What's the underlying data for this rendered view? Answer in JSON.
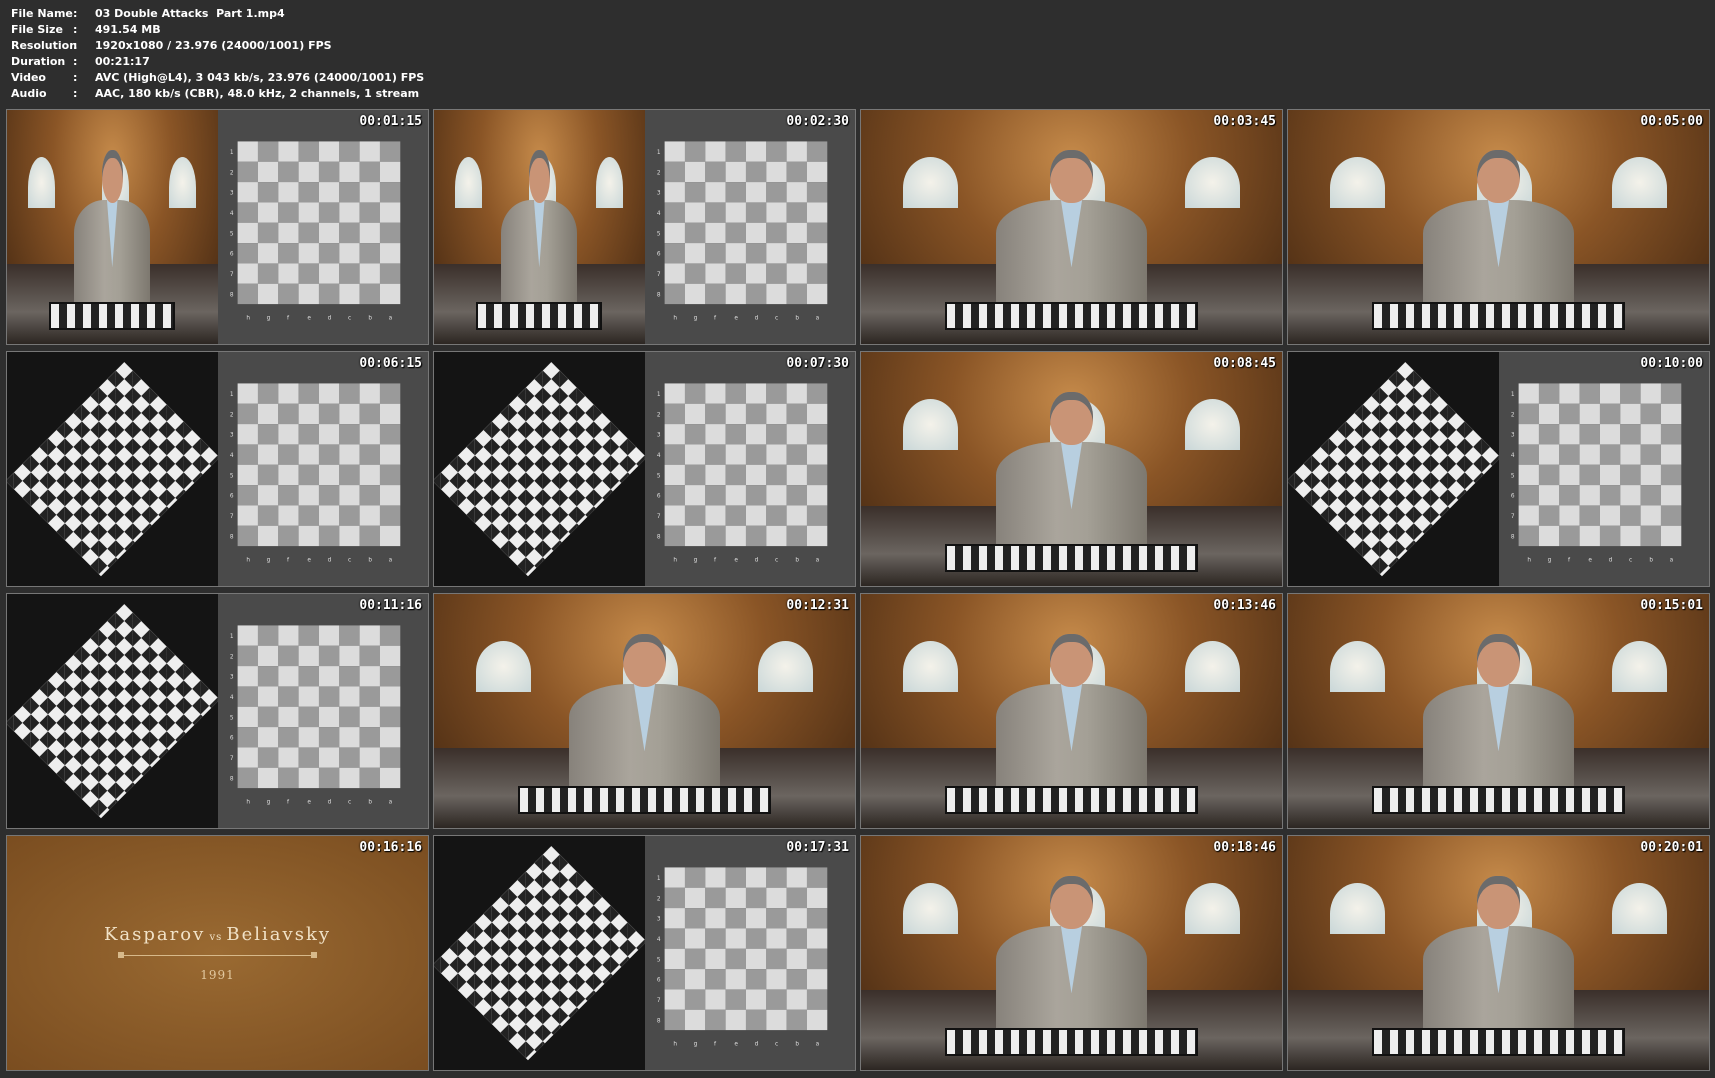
{
  "info": {
    "rows": [
      {
        "key": "File Name",
        "value": "03 Double Attacks  Part 1.mp4"
      },
      {
        "key": "File Size",
        "value": "491.54 MB"
      },
      {
        "key": "Resolution",
        "value": "1920x1080 / 23.976 (24000/1001) FPS"
      },
      {
        "key": "Duration",
        "value": "00:21:17"
      },
      {
        "key": "Video",
        "value": "AVC (High@L4), 3 043 kb/s, 23.976 (24000/1001) FPS"
      },
      {
        "key": "Audio",
        "value": "AAC, 180 kb/s (CBR), 48.0 kHz, 2 channels, 1 stream"
      }
    ],
    "separator": ":"
  },
  "thumbs": [
    {
      "time": "00:01:15",
      "scene": "studio+diagram"
    },
    {
      "time": "00:02:30",
      "scene": "studio+diagram"
    },
    {
      "time": "00:03:45",
      "scene": "studio"
    },
    {
      "time": "00:05:00",
      "scene": "studio"
    },
    {
      "time": "00:06:15",
      "scene": "overhead+diagram"
    },
    {
      "time": "00:07:30",
      "scene": "overhead+diagram"
    },
    {
      "time": "00:08:45",
      "scene": "studio"
    },
    {
      "time": "00:10:00",
      "scene": "overhead+diagram"
    },
    {
      "time": "00:11:16",
      "scene": "overhead+diagram"
    },
    {
      "time": "00:12:31",
      "scene": "studio"
    },
    {
      "time": "00:13:46",
      "scene": "studio"
    },
    {
      "time": "00:15:01",
      "scene": "studio"
    },
    {
      "time": "00:16:16",
      "scene": "title"
    },
    {
      "time": "00:17:31",
      "scene": "overhead+diagram"
    },
    {
      "time": "00:18:46",
      "scene": "studio"
    },
    {
      "time": "00:20:01",
      "scene": "studio"
    }
  ],
  "title_card": {
    "name_left": "Kasparov",
    "vs": "vs",
    "name_right": "Beliavsky",
    "year": "1991"
  },
  "board_files": [
    "h",
    "g",
    "f",
    "e",
    "d",
    "c",
    "b",
    "a"
  ],
  "board_ranks": [
    "1",
    "2",
    "3",
    "4",
    "5",
    "6",
    "7",
    "8"
  ],
  "colors": {
    "light_square": "#dcdcdc",
    "dark_square": "#9a9a9a",
    "highlight": "#f4e06a"
  }
}
